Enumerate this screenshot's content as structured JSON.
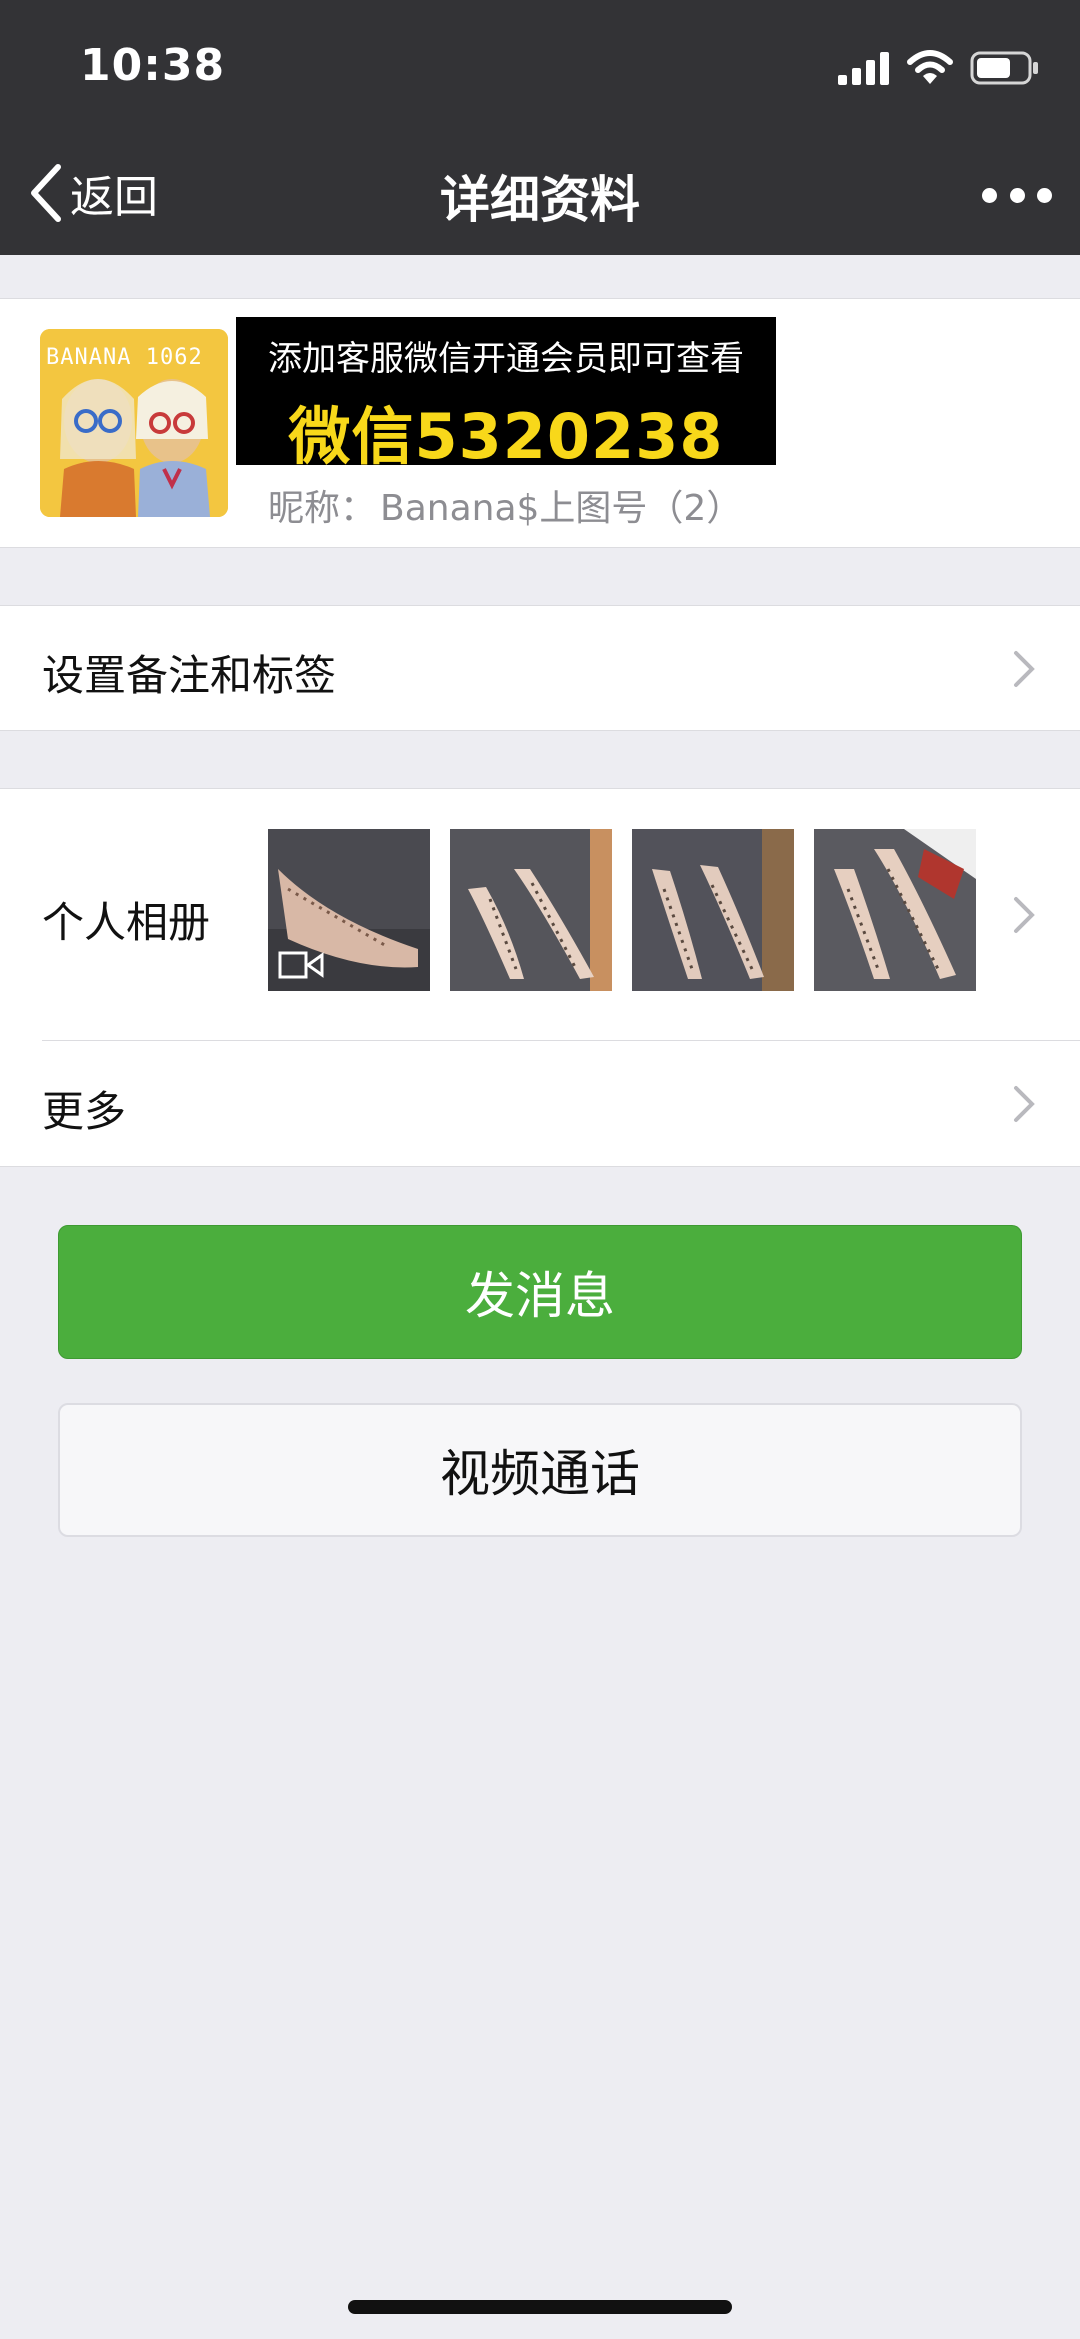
{
  "status_bar": {
    "time": "10:38",
    "icons": [
      "signal-icon",
      "wifi-icon",
      "battery-icon"
    ]
  },
  "nav": {
    "back_label": "返回",
    "title": "详细资料",
    "more_icon": "more-dots-icon"
  },
  "profile": {
    "avatar_text": "BANANA 1062",
    "promo_line1": "添加客服微信开通会员即可查看",
    "promo_line2": "微信5320238",
    "nickname_label": "昵称：",
    "nickname_value": "Banana$上图号（2）"
  },
  "list": {
    "remarks_label": "设置备注和标签",
    "album_label": "个人相册",
    "more_label": "更多"
  },
  "album": {
    "thumbnails": [
      "shoe-video-thumbnail",
      "shoe-photo-thumbnail",
      "shoe-photo-thumbnail",
      "shoe-photo-thumbnail"
    ]
  },
  "actions": {
    "send_message": "发消息",
    "video_call": "视频通话"
  },
  "colors": {
    "nav_bg": "#333336",
    "page_bg": "#ededf2",
    "primary_green": "#4bae3d",
    "promo_yellow": "#f8d81a"
  }
}
